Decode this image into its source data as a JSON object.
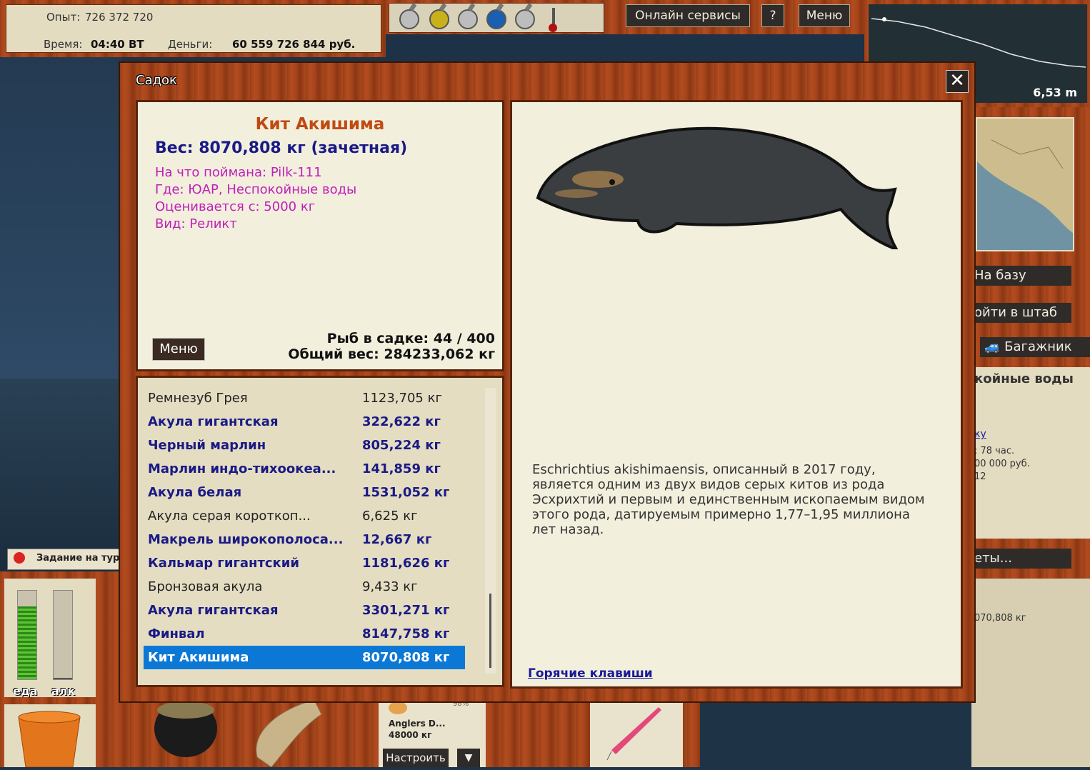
{
  "stats": {
    "exp_label": "Опыт:",
    "exp_value": "726 372 720",
    "time_label": "Время:",
    "time_value": "04:40 ВТ",
    "money_label": "Деньги:",
    "money_value": "60 559 726 844 руб."
  },
  "top_menu": {
    "online_services": "Онлайн сервисы",
    "help": "?",
    "menu": "Меню"
  },
  "depth": {
    "value": "6,53 m"
  },
  "right_panel": {
    "to_base": "На базу",
    "to_hq": "ойти в штаб",
    "trunk": "Багажник",
    "location_partial": "койные воды",
    "link_partial": "ку",
    "time_left": ": 78 час.",
    "money_partial": "00 000 руб.",
    "num_partial": "12",
    "more_partial": "еты...",
    "weight_partial": "070,808 кг"
  },
  "task": {
    "label": "Задание на тур"
  },
  "meters": {
    "food_label": "еда",
    "alc_label": "алк",
    "food_level": 0.82,
    "alc_level": 0.02
  },
  "bait": {
    "name": "Anglers D...",
    "weight": "48000 кг",
    "percent": "98%",
    "configure": "Настроить",
    "dropdown": "▼"
  },
  "dialog": {
    "title": "Садок",
    "close": "✕"
  },
  "fish": {
    "name": "Кит Акишима",
    "weight": "Вес: 8070,808 кг (зачетная)",
    "bait_line": "На что поймана: Pilk-111",
    "where_line": "Где: ЮАР, Неспокойные воды",
    "rated_line": "Оценивается с: 5000 кг",
    "kind_line": "Вид: Реликт",
    "description": "Eschrichtius akishimaensis, описанный в 2017 году, является одним из двух видов серых китов из рода Эсхрихтий и первым и единственным ископаемым видом этого рода, датируемым примерно 1,77–1,95 миллиона лет назад."
  },
  "keep_net": {
    "menu_button": "Меню",
    "count_line": "Рыб в садке: 44 / 400",
    "total_line": "Общий вес: 284233,062 кг",
    "hotkeys": "Горячие клавиши",
    "rows": [
      {
        "name": "Ремнезуб Грея",
        "weight": "1123,705 кг",
        "style": "plain"
      },
      {
        "name": "Акула гигантская",
        "weight": "322,622 кг",
        "style": "caught"
      },
      {
        "name": "Черный марлин",
        "weight": "805,224 кг",
        "style": "caught"
      },
      {
        "name": "Марлин индо-тихоокеа...",
        "weight": "141,859 кг",
        "style": "caught"
      },
      {
        "name": "Акула белая",
        "weight": "1531,052 кг",
        "style": "caught"
      },
      {
        "name": "Акула серая короткоп...",
        "weight": "6,625 кг",
        "style": "plain"
      },
      {
        "name": "Макрель широкополоса...",
        "weight": "12,667 кг",
        "style": "caught"
      },
      {
        "name": "Кальмар гигантский",
        "weight": "1181,626 кг",
        "style": "caught"
      },
      {
        "name": "Бронзовая акула",
        "weight": "9,433 кг",
        "style": "plain"
      },
      {
        "name": "Акула гигантская",
        "weight": "3301,271 кг",
        "style": "caught"
      },
      {
        "name": "Финвал",
        "weight": "8147,758 кг",
        "style": "caught"
      },
      {
        "name": "Кит Акишима",
        "weight": "8070,808 кг",
        "style": "selected"
      }
    ]
  }
}
